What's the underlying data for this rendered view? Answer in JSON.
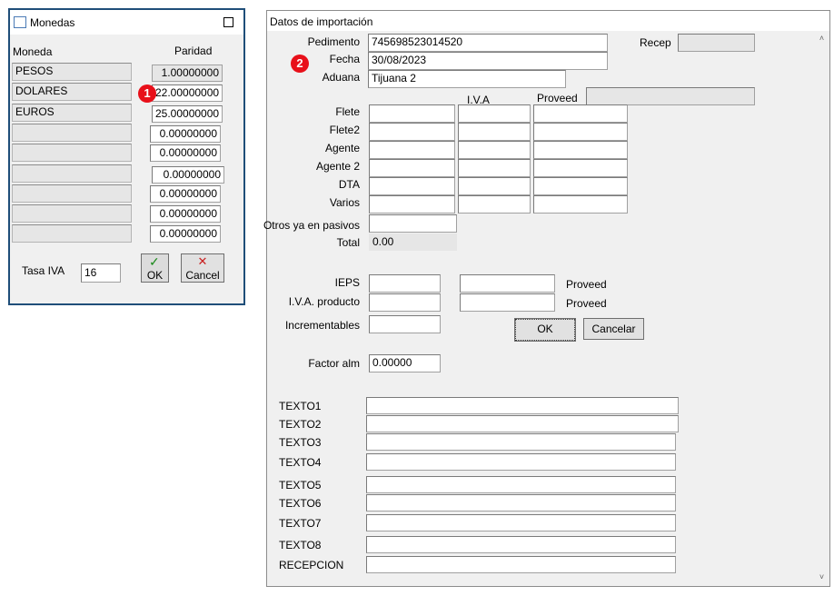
{
  "monedas": {
    "title": "Monedas",
    "col_moneda": "Moneda",
    "col_paridad": "Paridad",
    "rows": [
      {
        "moneda": "PESOS",
        "paridad": "1.00000000"
      },
      {
        "moneda": "DOLARES",
        "paridad": "22.00000000"
      },
      {
        "moneda": "EUROS",
        "paridad": "25.00000000"
      },
      {
        "moneda": "",
        "paridad": "0.00000000"
      },
      {
        "moneda": "",
        "paridad": "0.00000000"
      },
      {
        "moneda": "",
        "paridad": "0.00000000"
      },
      {
        "moneda": "",
        "paridad": "0.00000000"
      },
      {
        "moneda": "",
        "paridad": "0.00000000"
      },
      {
        "moneda": "",
        "paridad": "0.00000000"
      }
    ],
    "tasa_iva_label": "Tasa IVA",
    "tasa_iva_value": "16",
    "ok_label": "OK",
    "cancel_label": "Cancel",
    "ok_icon": "check-icon",
    "cancel_icon": "x-icon",
    "badge": "1"
  },
  "importacion": {
    "title": "Datos de importación",
    "badge": "2",
    "pedimento_label": "Pedimento",
    "pedimento_value": "745698523014520",
    "recep_label": "Recep",
    "recep_value": "",
    "fecha_label": "Fecha",
    "fecha_value": "30/08/2023",
    "aduana_label": "Aduana",
    "aduana_value": "Tijuana 2",
    "iva_header": "I.V.A",
    "proveed_header": "Proveed",
    "proveed_header_value": "",
    "cost_rows": [
      {
        "label": "Flete",
        "monto": "",
        "iva": "",
        "proveed": ""
      },
      {
        "label": "Flete2",
        "monto": "",
        "iva": "",
        "proveed": ""
      },
      {
        "label": "Agente",
        "monto": "",
        "iva": "",
        "proveed": ""
      },
      {
        "label": "Agente 2",
        "monto": "",
        "iva": "",
        "proveed": ""
      },
      {
        "label": "DTA",
        "monto": "",
        "iva": "",
        "proveed": ""
      },
      {
        "label": "Varios",
        "monto": "",
        "iva": "",
        "proveed": ""
      }
    ],
    "otros_label": "Otros ya en pasivos",
    "otros_value": "",
    "total_label": "Total",
    "total_value": "0.00",
    "ieps_label": "IEPS",
    "ieps_value": "",
    "ieps_proveed_value": "",
    "ieps_proveed_label": "Proveed",
    "iva_producto_label": "I.V.A. producto",
    "iva_producto_value": "",
    "iva_producto_proveed_value": "",
    "iva_producto_proveed_label": "Proveed",
    "incrementables_label": "Incrementables",
    "incrementables_value": "",
    "ok_label": "OK",
    "cancelar_label": "Cancelar",
    "factor_label": "Factor alm",
    "factor_value": "0.00000",
    "textos": [
      {
        "label": "TEXTO1",
        "value": ""
      },
      {
        "label": "TEXTO2",
        "value": ""
      },
      {
        "label": "TEXTO3",
        "value": ""
      },
      {
        "label": "TEXTO4",
        "value": ""
      },
      {
        "label": "TEXTO5",
        "value": ""
      },
      {
        "label": "TEXTO6",
        "value": ""
      },
      {
        "label": "TEXTO7",
        "value": ""
      },
      {
        "label": "TEXTO8",
        "value": ""
      },
      {
        "label": "RECEPCION",
        "value": ""
      }
    ]
  },
  "colors": {
    "window_border": "#1f4e79",
    "form_bg": "#f0f0f0",
    "badge_red": "#e8101a",
    "check_green": "#1b8a1b",
    "cross_red": "#c81e1e"
  }
}
